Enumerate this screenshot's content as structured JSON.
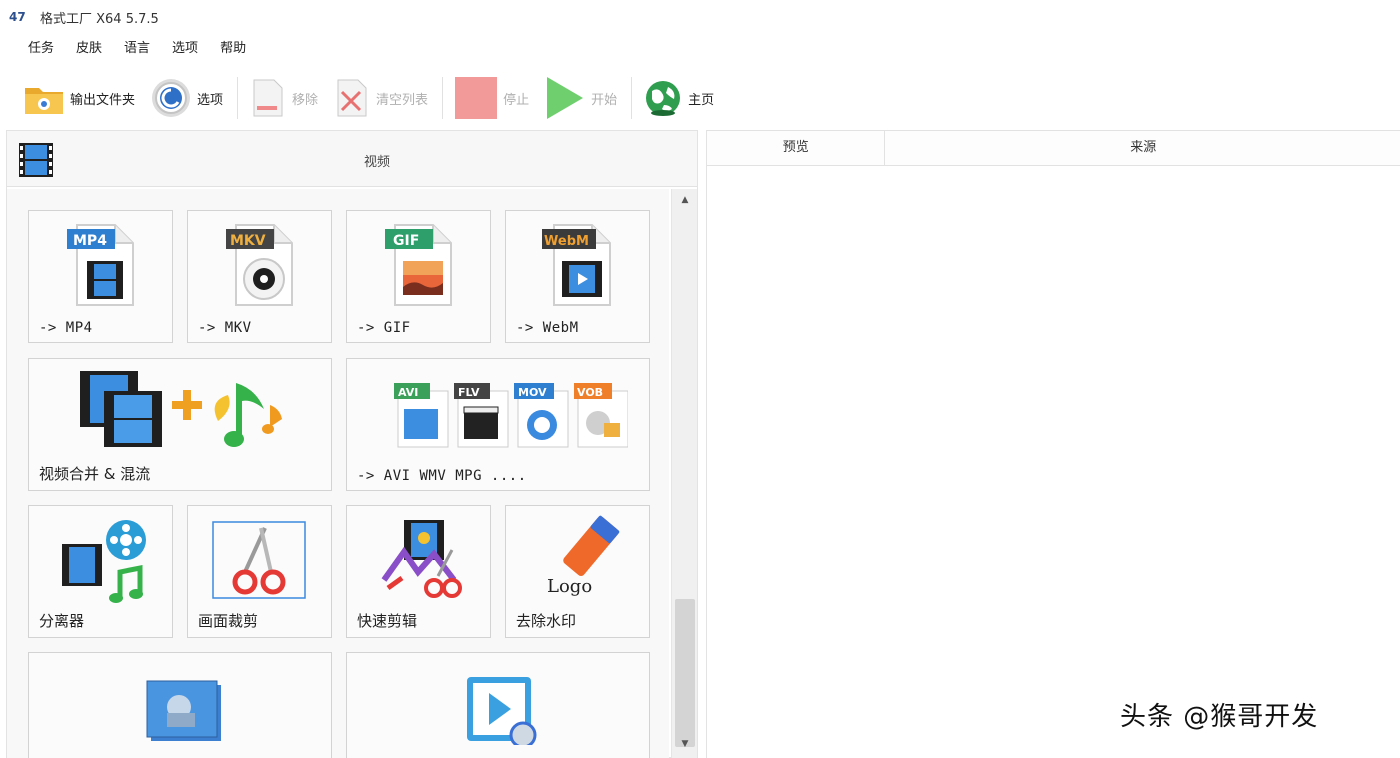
{
  "window": {
    "title": "格式工厂 X64 5.7.5"
  },
  "menu": [
    "任务",
    "皮肤",
    "语言",
    "选项",
    "帮助"
  ],
  "toolbar": {
    "output_folder": "输出文件夹",
    "options": "选项",
    "remove": "移除",
    "clear_list": "清空列表",
    "stop": "停止",
    "start": "开始",
    "home": "主页"
  },
  "category": {
    "title": "视频"
  },
  "tiles": [
    {
      "label": "-> MP4",
      "badge": "MP4",
      "badge_color": "#2f7fd0"
    },
    {
      "label": "-> MKV",
      "badge": "MKV",
      "badge_color": "#444444"
    },
    {
      "label": "-> GIF",
      "badge": "GIF",
      "badge_color": "#2e9e6b"
    },
    {
      "label": "-> WebM",
      "badge": "WebM",
      "badge_color": "#3b3b3b"
    },
    {
      "label": "视频合并 & 混流"
    },
    {
      "label": "-> AVI WMV MPG ....",
      "badges": [
        "AVI",
        "FLV",
        "MOV",
        "VOB"
      ]
    },
    {
      "label": "分离器"
    },
    {
      "label": "画面裁剪"
    },
    {
      "label": "快速剪辑"
    },
    {
      "label": "去除水印",
      "logo_text": "Logo"
    },
    {
      "label": ""
    },
    {
      "label": ""
    }
  ],
  "list": {
    "columns": [
      "预览",
      "来源"
    ]
  },
  "watermark": "头条 @猴哥开发",
  "colors": {
    "stop": "#f08a8a",
    "start": "#5cc45c",
    "accent": "#2f7fd0"
  }
}
